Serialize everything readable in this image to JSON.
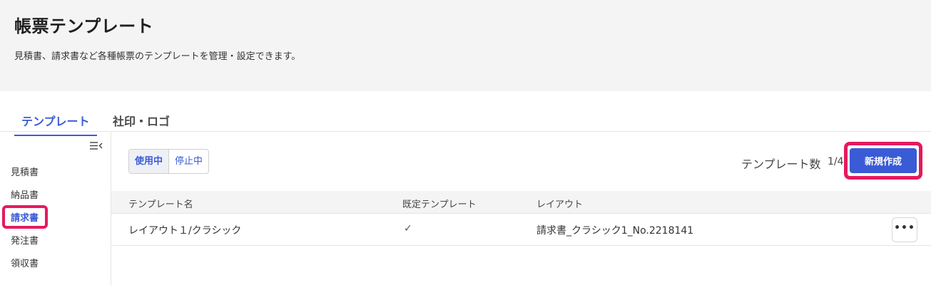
{
  "header": {
    "title": "帳票テンプレート",
    "description": "見積書、請求書など各種帳票のテンプレートを管理・設定できます。"
  },
  "tabs": [
    {
      "label": "テンプレート",
      "active": true
    },
    {
      "label": "社印・ロゴ",
      "active": false
    }
  ],
  "sidebar": {
    "items": [
      {
        "label": "見積書",
        "active": false
      },
      {
        "label": "納品書",
        "active": false
      },
      {
        "label": "請求書",
        "active": true
      },
      {
        "label": "発注書",
        "active": false
      },
      {
        "label": "領収書",
        "active": false
      }
    ]
  },
  "filter": {
    "active_label": "使用中",
    "inactive_label": "停止中"
  },
  "count": {
    "label": "テンプレート数",
    "value": "1/4"
  },
  "toolbar": {
    "new_label": "新規作成"
  },
  "table": {
    "headers": [
      "テンプレート名",
      "既定テンプレート",
      "レイアウト"
    ],
    "rows": [
      {
        "name": "レイアウト１/クラシック",
        "default_mark": "✓",
        "layout": "請求書_クラシック1_No.2218141"
      }
    ],
    "more_label": "•••"
  },
  "colors": {
    "accent": "#3a5bd6",
    "highlight": "#e5195e",
    "header_bg": "#f5f4f5"
  }
}
